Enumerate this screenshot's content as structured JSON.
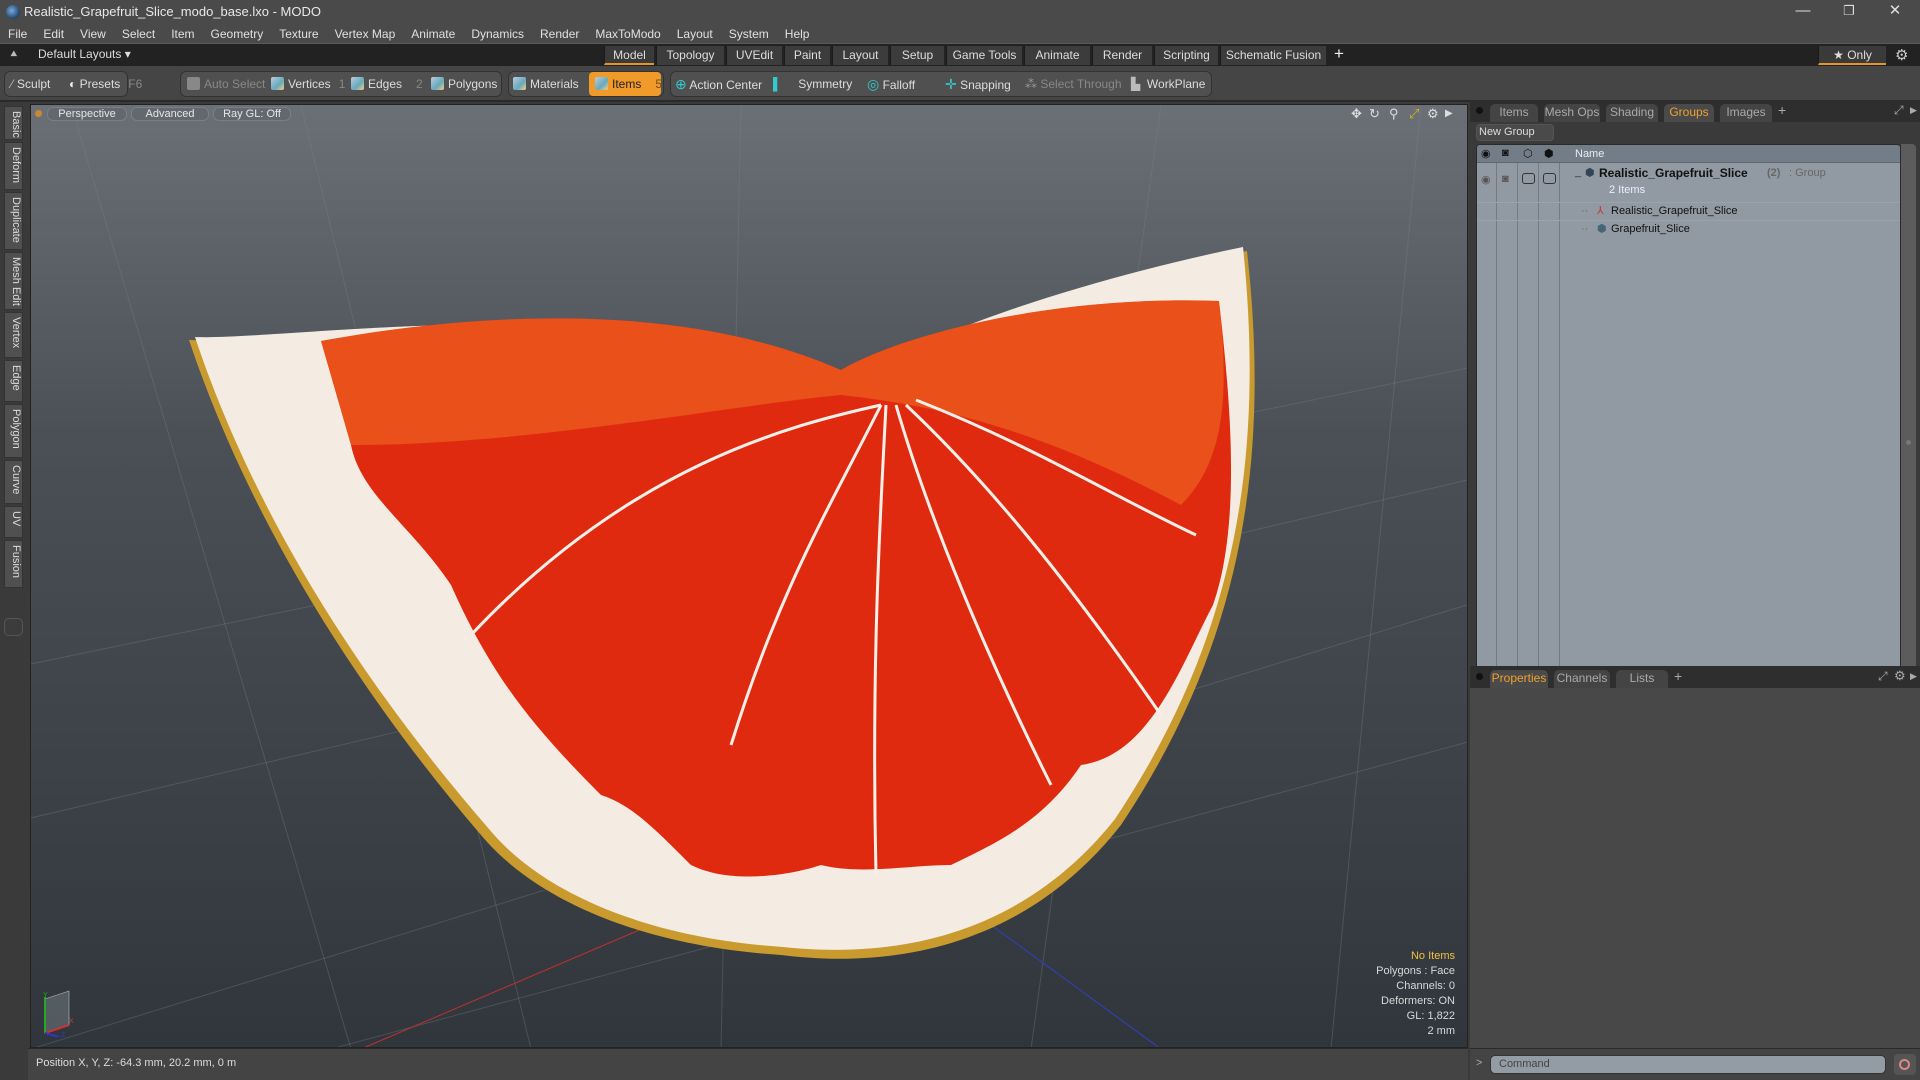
{
  "window": {
    "title": "Realistic_Grapefruit_Slice_modo_base.lxo - MODO",
    "minimize": "—",
    "restore": "❐",
    "close": "✕"
  },
  "menu": [
    "File",
    "Edit",
    "View",
    "Select",
    "Item",
    "Geometry",
    "Texture",
    "Vertex Map",
    "Animate",
    "Dynamics",
    "Render",
    "MaxToModo",
    "Layout",
    "System",
    "Help"
  ],
  "layout_bar": {
    "layouts_label": "Default Layouts ▾",
    "tabs": [
      "Model",
      "Topology",
      "UVEdit",
      "Paint",
      "Layout",
      "Setup",
      "Game Tools",
      "Animate",
      "Render",
      "Scripting",
      "Schematic Fusion"
    ],
    "active_tab": "Model",
    "add": "+",
    "only": "★  Only",
    "gear": "⚙"
  },
  "toolbar": {
    "sculpt": "Sculpt",
    "presets": "Presets",
    "presets_key": "F6",
    "auto_select": "Auto Select",
    "vertices": "Vertices",
    "vertices_key": "1",
    "edges": "Edges",
    "edges_key": "2",
    "polygons": "Polygons",
    "materials": "Materials",
    "items": "Items",
    "items_key": "5",
    "action_center": "Action Center",
    "symmetry": "Symmetry",
    "falloff": "Falloff",
    "snapping": "Snapping",
    "select_through": "Select Through",
    "workplane": "WorkPlane"
  },
  "left_tabs": [
    "Basic",
    "Deform",
    "Duplicate",
    "Mesh Edit",
    "Vertex",
    "Edge",
    "Polygon",
    "Curve",
    "UV",
    "Fusion"
  ],
  "viewport": {
    "view_mode": "Perspective",
    "shading": "Advanced",
    "raygl": "Ray GL: Off",
    "hud": {
      "selection": "No Items",
      "polygons": "Polygons : Face",
      "channels": "Channels: 0",
      "deformers": "Deformers: ON",
      "gl": "GL: 1,822",
      "grid": "2 mm"
    },
    "axis": {
      "x": "X",
      "y": "Y",
      "z": "Z"
    }
  },
  "groups_panel": {
    "tabs": [
      "Items",
      "Mesh Ops",
      "Shading",
      "Groups",
      "Images"
    ],
    "active_tab": "Groups",
    "new_group": "New Group",
    "column_name": "Name",
    "group": {
      "name": "Realistic_Grapefruit_Slice",
      "count": "(2)",
      "type": ": Group",
      "subtitle": "2 Items"
    },
    "children": [
      "Realistic_Grapefruit_Slice",
      "Grapefruit_Slice"
    ]
  },
  "properties_panel": {
    "tabs": [
      "Properties",
      "Channels",
      "Lists"
    ],
    "active_tab": "Properties"
  },
  "status": {
    "position": "Position X, Y, Z:   -64.3 mm, 20.2 mm, 0 m"
  },
  "command": {
    "placeholder": "Command",
    "prompt": ">"
  }
}
